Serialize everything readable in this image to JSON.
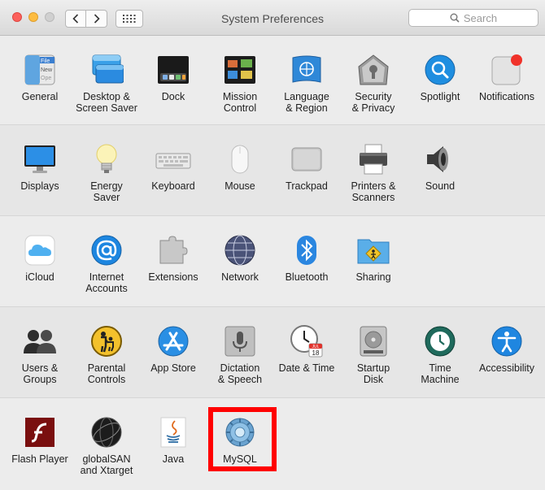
{
  "window": {
    "title": "System Preferences"
  },
  "toolbar": {
    "search_placeholder": "Search"
  },
  "rows": [
    {
      "items": [
        {
          "label": "General",
          "icon": "general-icon"
        },
        {
          "label": "Desktop &\nScreen Saver",
          "icon": "desktop-screen-saver-icon"
        },
        {
          "label": "Dock",
          "icon": "dock-icon"
        },
        {
          "label": "Mission\nControl",
          "icon": "mission-control-icon"
        },
        {
          "label": "Language\n& Region",
          "icon": "language-region-icon"
        },
        {
          "label": "Security\n& Privacy",
          "icon": "security-privacy-icon"
        },
        {
          "label": "Spotlight",
          "icon": "spotlight-icon"
        },
        {
          "label": "Notifications",
          "icon": "notifications-icon"
        }
      ]
    },
    {
      "items": [
        {
          "label": "Displays",
          "icon": "displays-icon"
        },
        {
          "label": "Energy\nSaver",
          "icon": "energy-saver-icon"
        },
        {
          "label": "Keyboard",
          "icon": "keyboard-icon"
        },
        {
          "label": "Mouse",
          "icon": "mouse-icon"
        },
        {
          "label": "Trackpad",
          "icon": "trackpad-icon"
        },
        {
          "label": "Printers &\nScanners",
          "icon": "printers-scanners-icon"
        },
        {
          "label": "Sound",
          "icon": "sound-icon"
        }
      ]
    },
    {
      "items": [
        {
          "label": "iCloud",
          "icon": "icloud-icon"
        },
        {
          "label": "Internet\nAccounts",
          "icon": "internet-accounts-icon"
        },
        {
          "label": "Extensions",
          "icon": "extensions-icon"
        },
        {
          "label": "Network",
          "icon": "network-icon"
        },
        {
          "label": "Bluetooth",
          "icon": "bluetooth-icon"
        },
        {
          "label": "Sharing",
          "icon": "sharing-icon"
        }
      ]
    },
    {
      "items": [
        {
          "label": "Users &\nGroups",
          "icon": "users-groups-icon"
        },
        {
          "label": "Parental\nControls",
          "icon": "parental-controls-icon"
        },
        {
          "label": "App Store",
          "icon": "app-store-icon"
        },
        {
          "label": "Dictation\n& Speech",
          "icon": "dictation-speech-icon"
        },
        {
          "label": "Date & Time",
          "icon": "date-time-icon"
        },
        {
          "label": "Startup\nDisk",
          "icon": "startup-disk-icon"
        },
        {
          "label": "Time\nMachine",
          "icon": "time-machine-icon"
        },
        {
          "label": "Accessibility",
          "icon": "accessibility-icon"
        }
      ]
    },
    {
      "items": [
        {
          "label": "Flash Player",
          "icon": "flash-player-icon"
        },
        {
          "label": "globalSAN\nand Xtarget",
          "icon": "globalsan-icon"
        },
        {
          "label": "Java",
          "icon": "java-icon"
        },
        {
          "label": "MySQL",
          "icon": "mysql-icon"
        }
      ]
    }
  ],
  "icon_text": {
    "general": [
      "File",
      "New",
      "Ope"
    ],
    "date_time": [
      "JUL",
      "18"
    ]
  },
  "colors": {
    "highlight": "#ff0000",
    "close": "#fc605b",
    "minimize": "#fdbc40",
    "zoom_disabled": "#d0d0d0"
  }
}
